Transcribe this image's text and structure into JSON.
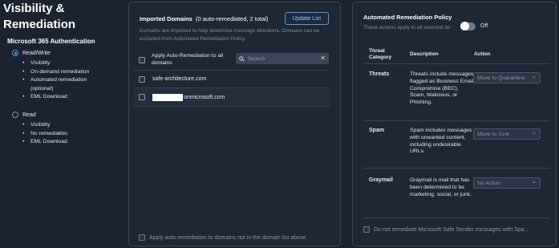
{
  "page": {
    "title": "Visibility & Remediation"
  },
  "auth": {
    "heading": "Microsoft 365 Authentication",
    "options": [
      {
        "label": "Read/Write",
        "selected": true,
        "features": [
          "Visibility",
          "On-demand remediation",
          "Automated remediation",
          "(optional)",
          "EML Download"
        ]
      },
      {
        "label": "Read",
        "selected": false,
        "features": [
          "Visibility",
          "No remediation",
          "EML Download"
        ]
      }
    ]
  },
  "domains": {
    "title": "Imported Domains",
    "count_text": "(0 auto-remediated, 2 total)",
    "update_button": "Update List",
    "description": "Domains are imported to help determine message directions. Domains can be excluded from Automated Remediation Policy.",
    "apply_all_label": "Apply Auto-Remediation to all domains",
    "search_placeholder": "Search",
    "rows": [
      {
        "name": "safe-architecture.com"
      },
      {
        "name": "onmicrosoft.com"
      }
    ],
    "footer_label": "Apply auto-remediation to domains not in the domain list above."
  },
  "policy": {
    "title": "Automated Remediation Policy",
    "description": "These actions apply to all selected do",
    "toggle_label": "Off",
    "columns": {
      "category": "Threat Category",
      "description": "Description",
      "action": "Action"
    },
    "rows": [
      {
        "category": "Threats",
        "description": "Threats include messages flagged as Business Email Compromise (BEC), Scam, Malicious, or Phishing.",
        "action": "Move to Quarantine"
      },
      {
        "category": "Spam",
        "description": "Spam includes messages with unwanted content, including undesirable URLs.",
        "action": "Move to Junk"
      },
      {
        "category": "Graymail",
        "description": "Graymail is mail that has been determined to be marketing, social, or junk.",
        "action": "No Action"
      }
    ],
    "footer_label": "Do not remediate Microsoft Safe Sender messages with Spa..."
  },
  "colors": {
    "accent": "#4aa3df",
    "background": "#1b2330",
    "panel": "#1e2734"
  }
}
